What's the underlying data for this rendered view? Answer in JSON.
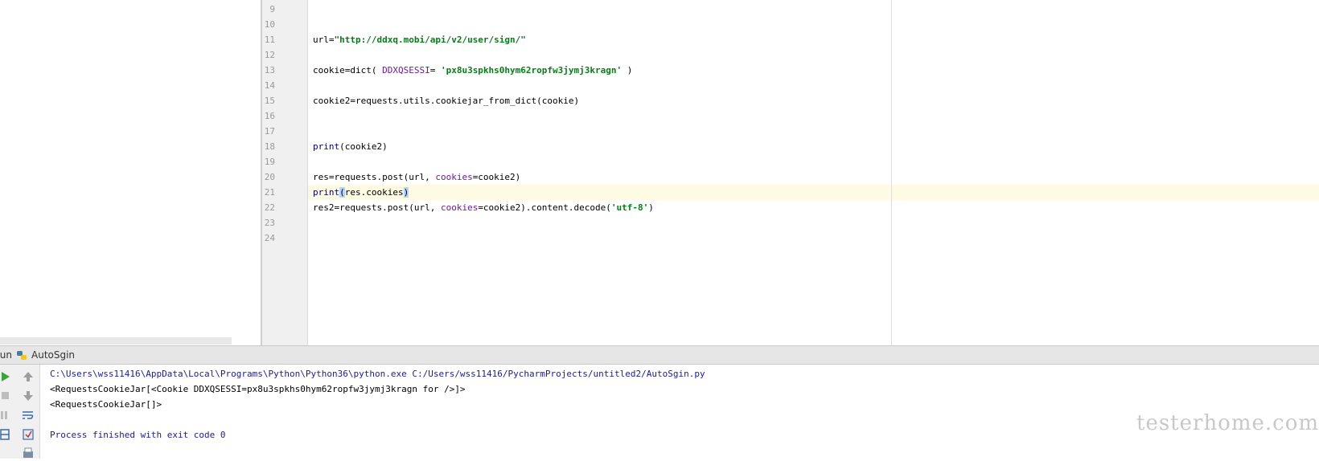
{
  "editor": {
    "lines": [
      {
        "number": "9",
        "tokens": []
      },
      {
        "number": "10",
        "tokens": []
      },
      {
        "number": "11",
        "tokens": [
          {
            "text": "url=",
            "cls": ""
          },
          {
            "text": "\"http://ddxq.mobi/api/v2/user/sign/\"",
            "cls": "tok-str"
          }
        ]
      },
      {
        "number": "12",
        "tokens": []
      },
      {
        "number": "13",
        "tokens": [
          {
            "text": "cookie=dict( ",
            "cls": ""
          },
          {
            "text": "DDXQSESSI",
            "cls": "tok-kw"
          },
          {
            "text": "= ",
            "cls": ""
          },
          {
            "text": "'px8u3spkhs0hym62ropfw3jymj3kragn'",
            "cls": "tok-str"
          },
          {
            "text": " )",
            "cls": ""
          }
        ]
      },
      {
        "number": "14",
        "tokens": []
      },
      {
        "number": "15",
        "tokens": [
          {
            "text": "cookie2=requests.utils.cookiejar_from_dict(cookie)",
            "cls": ""
          }
        ]
      },
      {
        "number": "16",
        "tokens": []
      },
      {
        "number": "17",
        "tokens": []
      },
      {
        "number": "18",
        "tokens": [
          {
            "text": "print",
            "cls": "tok-builtin"
          },
          {
            "text": "(cookie2)",
            "cls": ""
          }
        ]
      },
      {
        "number": "19",
        "tokens": []
      },
      {
        "number": "20",
        "tokens": [
          {
            "text": "res=requests.post(url, ",
            "cls": ""
          },
          {
            "text": "cookies",
            "cls": "tok-kw"
          },
          {
            "text": "=cookie2)",
            "cls": ""
          }
        ]
      },
      {
        "number": "21",
        "tokens": [
          {
            "text": "print",
            "cls": "tok-builtin"
          },
          {
            "text": "(",
            "cls": "caret-match"
          },
          {
            "text": "res.cookies",
            "cls": ""
          },
          {
            "text": ")",
            "cls": "caret-match"
          }
        ]
      },
      {
        "number": "22",
        "tokens": [
          {
            "text": "res2=requests.post(url, ",
            "cls": ""
          },
          {
            "text": "cookies",
            "cls": "tok-kw"
          },
          {
            "text": "=cookie2).content.decode(",
            "cls": ""
          },
          {
            "text": "'utf-8'",
            "cls": "tok-str"
          },
          {
            "text": ")",
            "cls": ""
          }
        ]
      },
      {
        "number": "23",
        "tokens": []
      },
      {
        "number": "24",
        "tokens": []
      }
    ]
  },
  "run_panel": {
    "title": "Run",
    "config_name": "AutoSgin",
    "console": [
      {
        "text": "C:\\Users\\wss11416\\AppData\\Local\\Programs\\Python\\Python36\\python.exe C:/Users/wss11416/PycharmProjects/untitled2/AutoSgin.py",
        "cls": "console-path"
      },
      {
        "text": "<RequestsCookieJar[<Cookie DDXQSESSI=px8u3spkhs0hym62ropfw3jymj3kragn for />]>",
        "cls": "console-out"
      },
      {
        "text": "<RequestsCookieJar[]>",
        "cls": "console-out"
      },
      {
        "text": "",
        "cls": "console-out"
      },
      {
        "text": "Process finished with exit code 0",
        "cls": "console-exit"
      }
    ],
    "toolbar_icons": [
      "run-icon",
      "up-arrow-icon",
      "stop-icon",
      "down-arrow-icon",
      "pause-icon",
      "soft-wrap-icon",
      "layout-icon",
      "pin-icon",
      "print-icon"
    ]
  },
  "watermark": "testerhome.com",
  "colors": {
    "string": "#067d17",
    "keyword_arg": "#6a1b9a",
    "builtin": "#000080",
    "current_line": "#fffae3",
    "console_path": "#1a1aa6"
  }
}
